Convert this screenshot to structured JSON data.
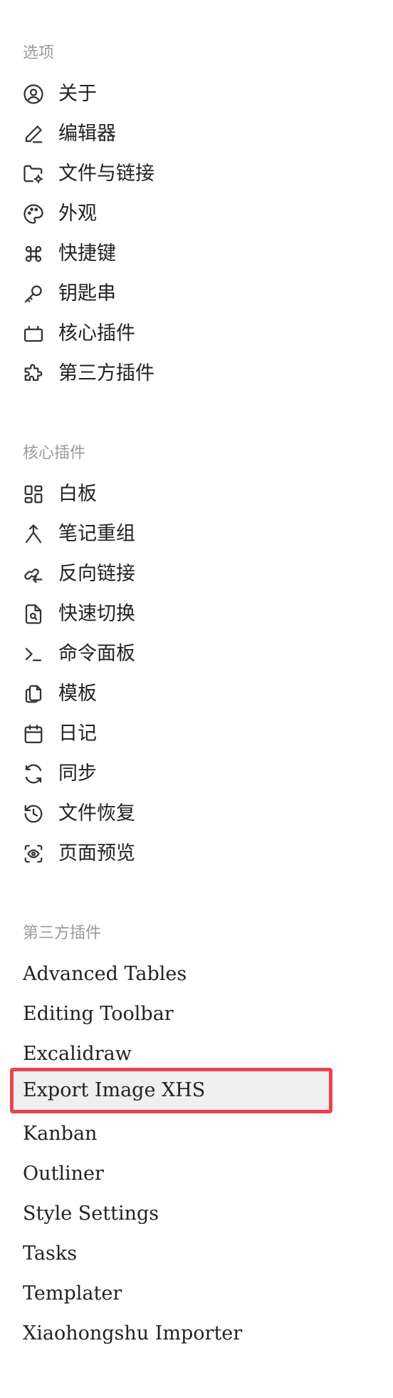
{
  "accent_color": "#e8454e",
  "sections": [
    {
      "title": "选项",
      "items": [
        {
          "label": "关于",
          "icon": "user-circle-icon"
        },
        {
          "label": "编辑器",
          "icon": "pencil-icon"
        },
        {
          "label": "文件与链接",
          "icon": "folder-gear-icon"
        },
        {
          "label": "外观",
          "icon": "palette-icon"
        },
        {
          "label": "快捷键",
          "icon": "command-icon"
        },
        {
          "label": "钥匙串",
          "icon": "key-icon"
        },
        {
          "label": "核心插件",
          "icon": "plug-box-icon"
        },
        {
          "label": "第三方插件",
          "icon": "puzzle-icon"
        }
      ]
    },
    {
      "title": "核心插件",
      "items": [
        {
          "label": "白板",
          "icon": "layout-grid-icon"
        },
        {
          "label": "笔记重组",
          "icon": "merge-icon"
        },
        {
          "label": "反向链接",
          "icon": "backlink-icon"
        },
        {
          "label": "快速切换",
          "icon": "file-search-icon"
        },
        {
          "label": "命令面板",
          "icon": "terminal-icon"
        },
        {
          "label": "模板",
          "icon": "files-icon"
        },
        {
          "label": "日记",
          "icon": "calendar-icon"
        },
        {
          "label": "同步",
          "icon": "sync-icon"
        },
        {
          "label": "文件恢复",
          "icon": "history-icon"
        },
        {
          "label": "页面预览",
          "icon": "eye-scan-icon"
        }
      ]
    },
    {
      "title": "第三方插件",
      "items": [
        {
          "label": "Advanced Tables"
        },
        {
          "label": "Editing Toolbar"
        },
        {
          "label": "Excalidraw"
        },
        {
          "label": "Export Image XHS",
          "selected": true
        },
        {
          "label": "Kanban"
        },
        {
          "label": "Outliner"
        },
        {
          "label": "Style Settings"
        },
        {
          "label": "Tasks"
        },
        {
          "label": "Templater"
        },
        {
          "label": "Xiaohongshu Importer"
        }
      ]
    }
  ]
}
